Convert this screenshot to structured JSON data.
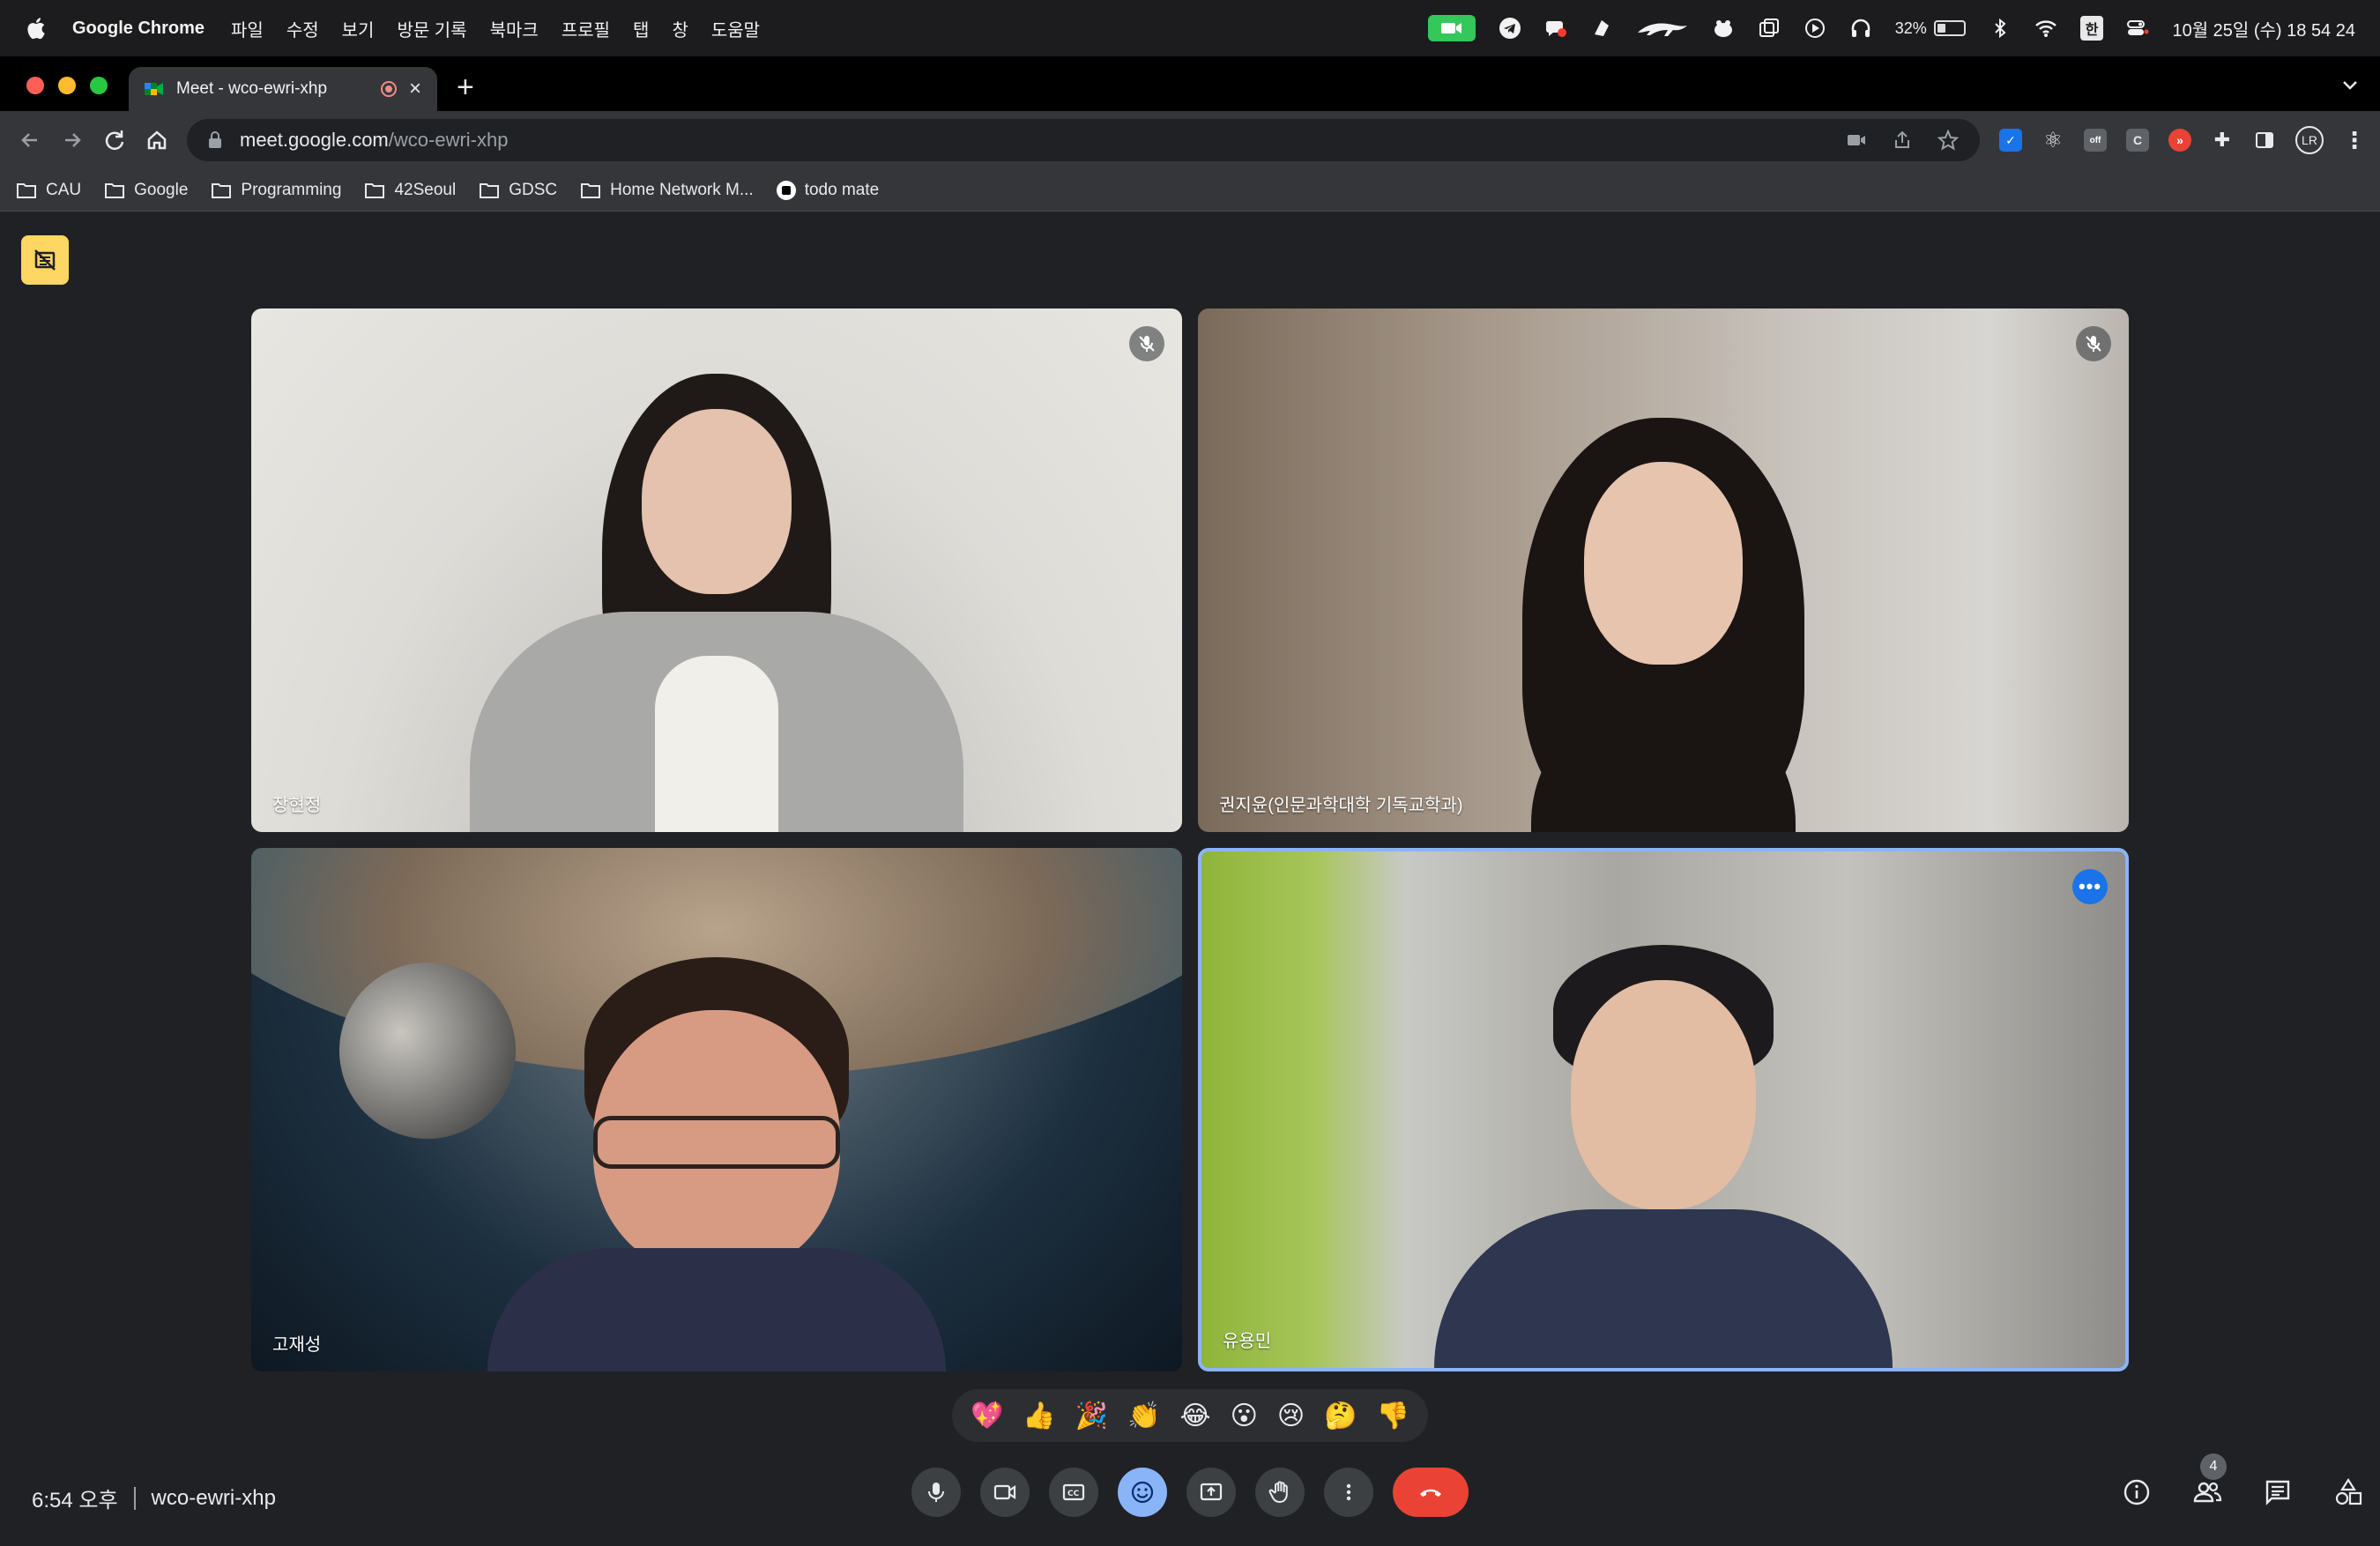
{
  "menubar": {
    "app_name": "Google Chrome",
    "items": [
      "파일",
      "수정",
      "보기",
      "방문 기록",
      "북마크",
      "프로필",
      "탭",
      "창",
      "도움말"
    ],
    "battery_percent": "32%",
    "battery_level": 0.32,
    "input_method": "한",
    "datetime": "10월 25일 (수) 18 54 24"
  },
  "browser": {
    "tab_title": "Meet - wco-ewri-xhp",
    "new_tab": "+",
    "url_host": "meet.google.com",
    "url_path": "/wco-ewri-xhp",
    "profile_initials": "LR",
    "bookmarks": [
      "CAU",
      "Google",
      "Programming",
      "42Seoul",
      "GDSC",
      "Home Network M...",
      "todo mate"
    ]
  },
  "meet": {
    "participants": [
      {
        "name": "장현정",
        "muted": true
      },
      {
        "name": "권지윤(인문과학대학 기독교학과)",
        "muted": true
      },
      {
        "name": "고재성",
        "muted": false
      },
      {
        "name": "유용민",
        "muted": false,
        "active": true
      }
    ],
    "reactions": [
      "💖",
      "👍",
      "🎉",
      "👏",
      "😂",
      "😮",
      "😢",
      "🤔",
      "👎"
    ],
    "time": "6:54 오후",
    "meeting_code": "wco-ewri-xhp",
    "participant_count": "4",
    "more_options": "•••",
    "colors": {
      "background": "#202124",
      "active_border": "#8ab4f8",
      "end_call": "#ea4335",
      "recording_badge": "#fdd663"
    }
  }
}
